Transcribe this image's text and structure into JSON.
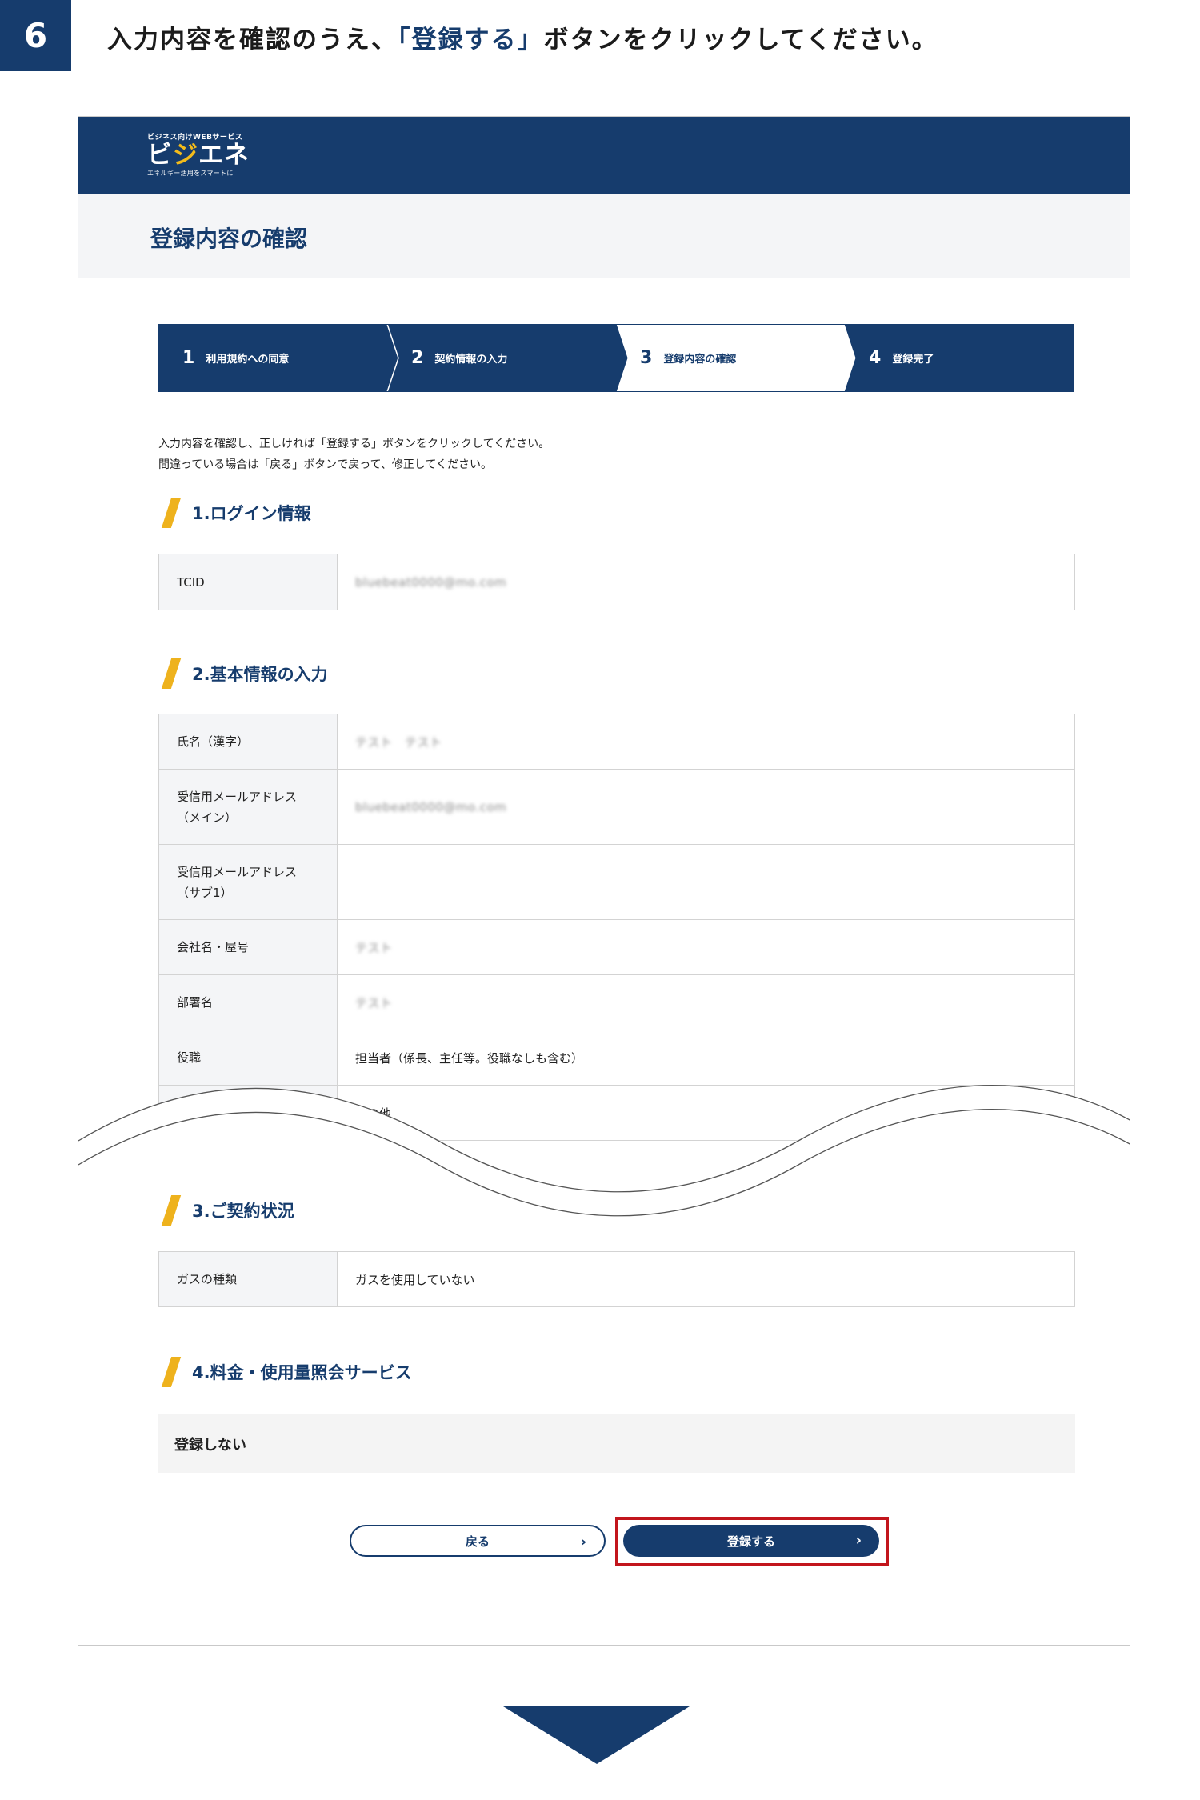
{
  "instruction": {
    "step_number": "6",
    "text_before": "入力内容を確認のうえ、",
    "text_highlight": "「登録する」",
    "text_after": "ボタンをクリックしてください。"
  },
  "site": {
    "logo_tagline": "ビジネス向けWEBサービス",
    "logo_name_left": "ビ",
    "logo_name_dot": "ジ",
    "logo_name_right": "エネ",
    "logo_subtitle": "エネルギー活用をスマートに",
    "page_title": "登録内容の確認"
  },
  "steps": [
    {
      "num": "1",
      "label": "利用規約への同意",
      "active": false
    },
    {
      "num": "2",
      "label": "契約情報の入力",
      "active": false
    },
    {
      "num": "3",
      "label": "登録内容の確認",
      "active": true
    },
    {
      "num": "4",
      "label": "登録完了",
      "active": false
    }
  ],
  "intro": {
    "line1": "入力内容を確認し、正しければ「登録する」ボタンをクリックしてください。",
    "line2": "間違っている場合は「戻る」ボタンで戻って、修正してください。"
  },
  "sections": {
    "login": {
      "title": "1.ログイン情報",
      "rows": [
        {
          "label": "TCID",
          "value": "bluebeat0000@mo.com"
        }
      ]
    },
    "basic": {
      "title": "2.基本情報の入力",
      "rows": [
        {
          "label": "氏名（漢字）",
          "value": "テスト　テスト"
        },
        {
          "label": "受信用メールアドレス（メイン）",
          "value": "bluebeat0000@mo.com"
        },
        {
          "label": "受信用メールアドレス（サブ1）",
          "value": ""
        },
        {
          "label": "会社名・屋号",
          "value": "テスト"
        },
        {
          "label": "部署名",
          "value": "テスト"
        },
        {
          "label": "役職",
          "value": "担当者（係長、主任等。役職なしも含む）"
        },
        {
          "label": "",
          "value": "その他"
        }
      ]
    },
    "contract": {
      "title": "3.ご契約状況",
      "rows": [
        {
          "label": "ガスの種類",
          "value": "ガスを使用していない"
        }
      ]
    },
    "service": {
      "title": "4.料金・使用量照会サービス",
      "value": "登録しない"
    }
  },
  "buttons": {
    "back": "戻る",
    "submit": "登録する",
    "chevron": "›"
  },
  "colors": {
    "brand_navy": "#163c6d",
    "accent_yellow": "#eeb21d",
    "highlight_red": "#c2151c",
    "header_band": "#f4f5f7"
  }
}
